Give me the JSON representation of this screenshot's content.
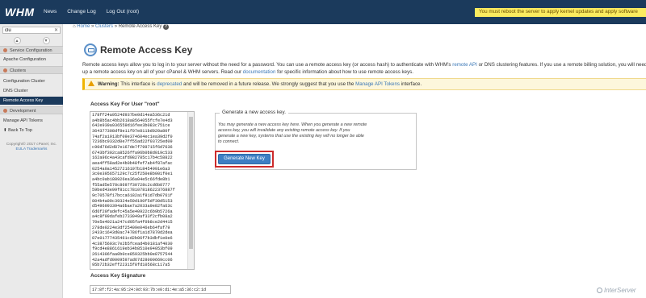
{
  "app": {
    "logo": "WHM",
    "nav": [
      "News",
      "Change Log",
      "Log Out (root)"
    ],
    "top_links": "- - - - - - - - - - -",
    "alert": "You must reboot the server to apply kernel updates and apply software"
  },
  "sidebar": {
    "search_value": "clu",
    "search_clear": "✕",
    "items": [
      {
        "label": "Service Configuration",
        "type": "category"
      },
      {
        "label": "Apache Configuration",
        "type": "item"
      },
      {
        "label": "Clusters",
        "type": "category"
      },
      {
        "label": "Configuration Cluster",
        "type": "item"
      },
      {
        "label": "DNS Cluster",
        "type": "item"
      },
      {
        "label": "Remote Access Key",
        "type": "active"
      },
      {
        "label": "Development",
        "type": "category"
      },
      {
        "label": "Manage API Tokens",
        "type": "item"
      },
      {
        "label": "Back To Top",
        "type": "item"
      }
    ],
    "footer_line1": "Copyright© 2017 cPanel, Inc.",
    "footer_eula": "EULA",
    "footer_trademarks": "Trademarks"
  },
  "breadcrumb": {
    "home": "Home",
    "sep1": "»",
    "section": "Clusters",
    "sep2": "»",
    "current": "Remote Access Key",
    "help": "?"
  },
  "page": {
    "title": "Remote Access Key",
    "description_a": "Remote access keys allow you to log in to your server without the need for a password. You can use a remote access key (or access hash) to authenticate with WHM's",
    "description_link1": "remote API",
    "description_b": "or DNS clustering features. If you use a remote billing solution, you will need to set up a remote access key on all of your cPanel & WHM servers. Read our",
    "description_link2": "documentation",
    "description_c": "for specific information about how to use remote access keys.",
    "warning_label": "Warning:",
    "warning_a": "This interface is",
    "warning_link1": "deprecated",
    "warning_b": "and will be removed in a future release. We strongly suggest that you use the",
    "warning_link2": "Manage API Tokens",
    "warning_c": "interface."
  },
  "key": {
    "label": "Access Key For User \"root\"",
    "value": "178ff24a9524d937be0d14ea536c21d a4b8b5ac4bb2618a8564055fcfe7e4d3 642e939a936559d16fee3b083c751ce 364377308df8e11f07e811bd020a80f 74af2a1913bf09e374604ec1ea39d2f0 7236bc9332d0e7ff55ad22f03725ed09 c90d76d2d87e167de7f799715f6d7636 6743bf302ca8526ffa96b0b8d019c533 162a96c4a43cafd982785c17b4c58822 aea4ff58ad2e4b0b48fef7ab4f87afac 0254a0a14527216197b18454991e6a3 3c0e395657129c7c25f250e8b001f0e1 a4bc0ab188926ea36a04e5c66fde8b1 f55ad5e578c8697f30728c2cd6b8777 59bed43e99f81cc78107818622376887f 9c70578f17bcca6182a1f81d7db0761f 804b4a09c39324e59d190f5df30d5153 d5496993394a6bae7a2033a9e82fa63c 6d6f20fadefc45a5e40922c6b9b5726a a4c8f99dafeb2733049af33f2cfb08a2 70e5e4021a247cd95fa4f0b8ce2d4415 278de0224e3df25409e046eb64faf79 2433c1643d0ac74786f1a1d7870d2dea 87e01777435461cd2b06f7b3dbf1e0e6 4c3875603c7e2b5fcead4b0181af4030 f9cd4e8861619eb34b8510e94053bf09 2614306faa0b0ce859325bb0e8757544 42a4adfd0009597ad67d28000669cc06 95b72b32eff22315f8fd10568c117a5",
    "signature_label": "Access Key Signature",
    "signature_value": "17:8f:f2:4a:95:24:0d:93:7b:e0:d1:4e:a5:36:c2:1d"
  },
  "generate": {
    "legend": "Generate a new access key.",
    "note": "You may generate a new access key here. When you generate a new remote access key, you will invalidate any existing remote access key. If you generate a new key, systems that use the existing key will no longer be able to connect.",
    "button": "Generate New Key"
  },
  "watermark": "InterServer"
}
